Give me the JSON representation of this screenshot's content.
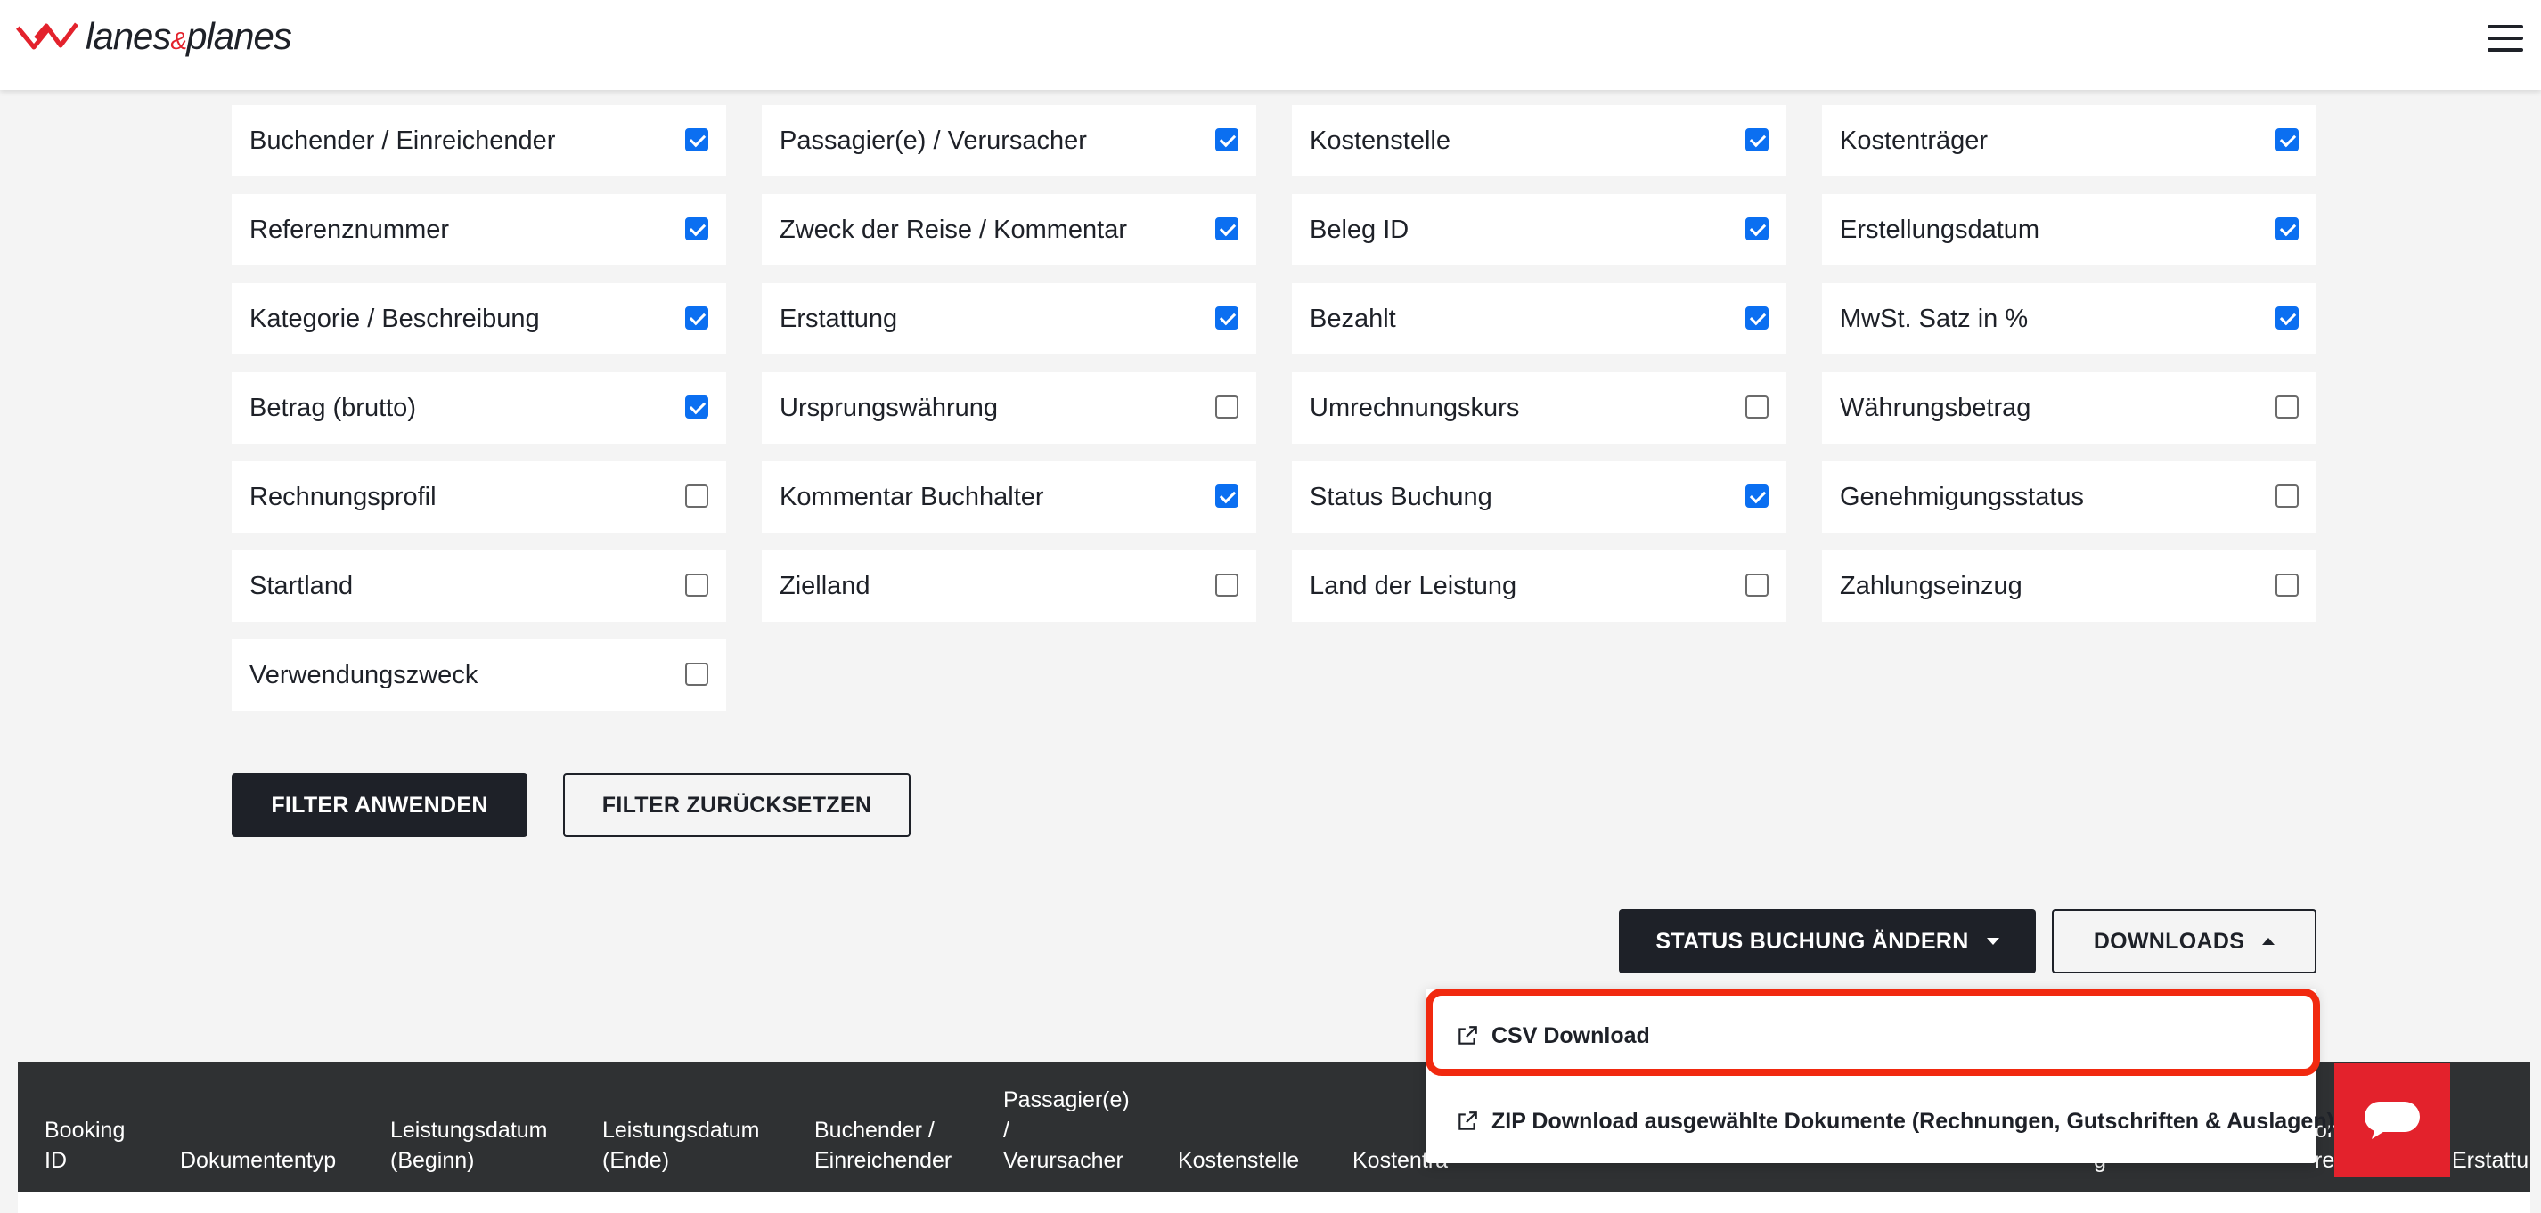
{
  "header": {
    "logo_text": "lanes",
    "logo_amp": "&",
    "logo_text2": "planes"
  },
  "columns": [
    {
      "label": "Buchender / Einreichender",
      "checked": true
    },
    {
      "label": "Passagier(e) / Verursacher",
      "checked": true
    },
    {
      "label": "Kostenstelle",
      "checked": true
    },
    {
      "label": "Kostenträger",
      "checked": true
    },
    {
      "label": "Referenznummer",
      "checked": true
    },
    {
      "label": "Zweck der Reise / Kommentar",
      "checked": true
    },
    {
      "label": "Beleg ID",
      "checked": true
    },
    {
      "label": "Erstellungsdatum",
      "checked": true
    },
    {
      "label": "Kategorie / Beschreibung",
      "checked": true
    },
    {
      "label": "Erstattung",
      "checked": true
    },
    {
      "label": "Bezahlt",
      "checked": true
    },
    {
      "label": "MwSt. Satz in %",
      "checked": true
    },
    {
      "label": "Betrag (brutto)",
      "checked": true
    },
    {
      "label": "Ursprungswährung",
      "checked": false
    },
    {
      "label": "Umrechnungskurs",
      "checked": false
    },
    {
      "label": "Währungsbetrag",
      "checked": false
    },
    {
      "label": "Rechnungsprofil",
      "checked": false
    },
    {
      "label": "Kommentar Buchhalter",
      "checked": true
    },
    {
      "label": "Status Buchung",
      "checked": true
    },
    {
      "label": "Genehmigungsstatus",
      "checked": false
    },
    {
      "label": "Startland",
      "checked": false
    },
    {
      "label": "Zielland",
      "checked": false
    },
    {
      "label": "Land der Leistung",
      "checked": false
    },
    {
      "label": "Zahlungseinzug",
      "checked": false
    },
    {
      "label": "Verwendungszweck",
      "checked": false
    }
  ],
  "filters": {
    "apply_label": "FILTER ANWENDEN",
    "reset_label": "FILTER ZURÜCKSETZEN"
  },
  "actions": {
    "status_label": "STATUS BUCHUNG ÄNDERN",
    "downloads_label": "DOWNLOADS"
  },
  "downloads_menu": {
    "csv_label": "CSV Download",
    "zip_label": "ZIP Download ausgewählte Dokumente (Rechnungen, Gutschriften & Auslagen)"
  },
  "table": {
    "headers": {
      "booking_id": [
        "Booking",
        "ID"
      ],
      "dokumententyp": "Dokumententyp",
      "leistungsdatum_beginn": [
        "Leistungsdatum",
        "(Beginn)"
      ],
      "leistungsdatum_ende": [
        "Leistungsdatum",
        "(Ende)"
      ],
      "buchender": [
        "Buchender /",
        "Einreichender"
      ],
      "passagier": [
        "Passagier(e)",
        "/",
        "Verursacher"
      ],
      "kostenstelle": "Kostenstelle",
      "kostentraeger_partial": "Kostenträ",
      "hidden_partial_1": "g",
      "hidden_partial_2": [
        "or",
        "re"
      ],
      "erstattung_partial": "Erstattu"
    }
  },
  "colors": {
    "accent_blue": "#0b6ff1",
    "brand_red": "#e3222c",
    "dark": "#1e2128",
    "highlight_red": "#f1290f"
  }
}
